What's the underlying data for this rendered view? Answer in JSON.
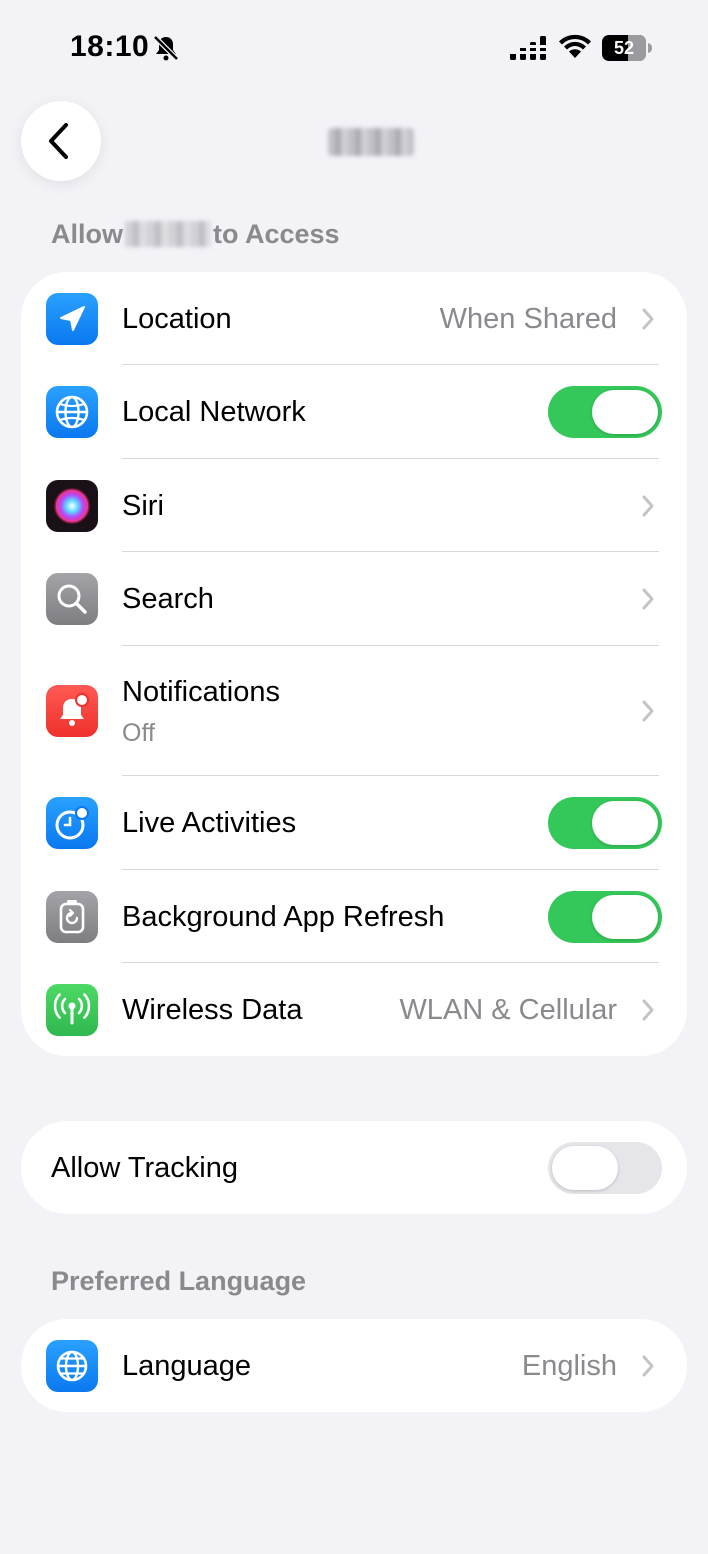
{
  "status_bar": {
    "time": "18:10",
    "battery": "52",
    "icons": [
      "bell-slash-icon",
      "cellular-signal-icon",
      "wifi-icon",
      "battery-icon"
    ]
  },
  "nav": {
    "back_icon": "chevron-left-icon"
  },
  "allow_section": {
    "header_prefix": "Allow",
    "header_suffix": "to Access",
    "rows": [
      {
        "label": "Location",
        "value": "When Shared",
        "icon": "location-arrow-icon",
        "control": "chevron"
      },
      {
        "label": "Local Network",
        "icon": "globe-network-icon",
        "control": "toggle",
        "toggle_on": true
      },
      {
        "label": "Siri",
        "icon": "siri-icon",
        "control": "chevron"
      },
      {
        "label": "Search",
        "icon": "magnifier-icon",
        "control": "chevron"
      },
      {
        "label": "Notifications",
        "sublabel": "Off",
        "icon": "notification-bell-icon",
        "control": "chevron"
      },
      {
        "label": "Live Activities",
        "icon": "live-activities-icon",
        "control": "toggle",
        "toggle_on": true
      },
      {
        "label": "Background App Refresh",
        "icon": "background-refresh-icon",
        "control": "toggle",
        "toggle_on": true
      },
      {
        "label": "Wireless Data",
        "value": "WLAN & Cellular",
        "icon": "antenna-icon",
        "control": "chevron"
      }
    ]
  },
  "tracking": {
    "label": "Allow Tracking",
    "toggle_on": false
  },
  "language_section": {
    "header": "Preferred Language",
    "row": {
      "label": "Language",
      "value": "English",
      "icon": "globe-icon"
    }
  },
  "colors": {
    "background": "#f2f2f7",
    "toggle_on": "#34c759",
    "toggle_off": "#e5e5ea",
    "secondary_text": "#8a8a8e",
    "icon_blue": "#1a8cff",
    "icon_red": "#ff3b30",
    "icon_green": "#34c759",
    "icon_gray": "#8e8e93"
  }
}
